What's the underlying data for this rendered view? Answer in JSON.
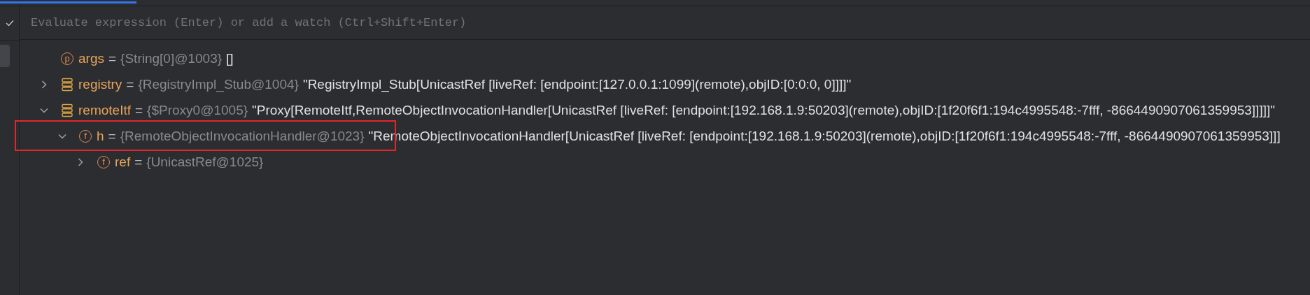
{
  "evaluate": {
    "placeholder": "Evaluate expression (Enter) or add a watch (Ctrl+Shift+Enter)"
  },
  "variables": [
    {
      "kind": "param",
      "badge": "p",
      "name": "args",
      "separator": "=",
      "type": "{String[0]@1003}",
      "value": "[]"
    },
    {
      "kind": "stack",
      "name": "registry",
      "separator": "=",
      "type": "{RegistryImpl_Stub@1004}",
      "value": "\"RegistryImpl_Stub[UnicastRef [liveRef: [endpoint:[127.0.0.1:1099](remote),objID:[0:0:0, 0]]]]\"",
      "expanded": false
    },
    {
      "kind": "stack",
      "name": "remoteItf",
      "separator": "=",
      "type": "{$Proxy0@1005}",
      "value": "\"Proxy[RemoteItf,RemoteObjectInvocationHandler[UnicastRef [liveRef: [endpoint:[192.168.1.9:50203](remote),objID:[1f20f6f1:194c4995548:-7fff, -8664490907061359953]]]]]\"",
      "expanded": true,
      "children": [
        {
          "kind": "field",
          "badge": "f",
          "name": "h",
          "separator": "=",
          "type": "{RemoteObjectInvocationHandler@1023}",
          "value": "\"RemoteObjectInvocationHandler[UnicastRef [liveRef: [endpoint:[192.168.1.9:50203](remote),objID:[1f20f6f1:194c4995548:-7fff, -8664490907061359953]]]",
          "expanded": true,
          "highlighted": true,
          "children": [
            {
              "kind": "field",
              "badge": "f",
              "name": "ref",
              "separator": "=",
              "type": "{UnicastRef@1025}",
              "expanded": false
            }
          ]
        }
      ]
    }
  ]
}
